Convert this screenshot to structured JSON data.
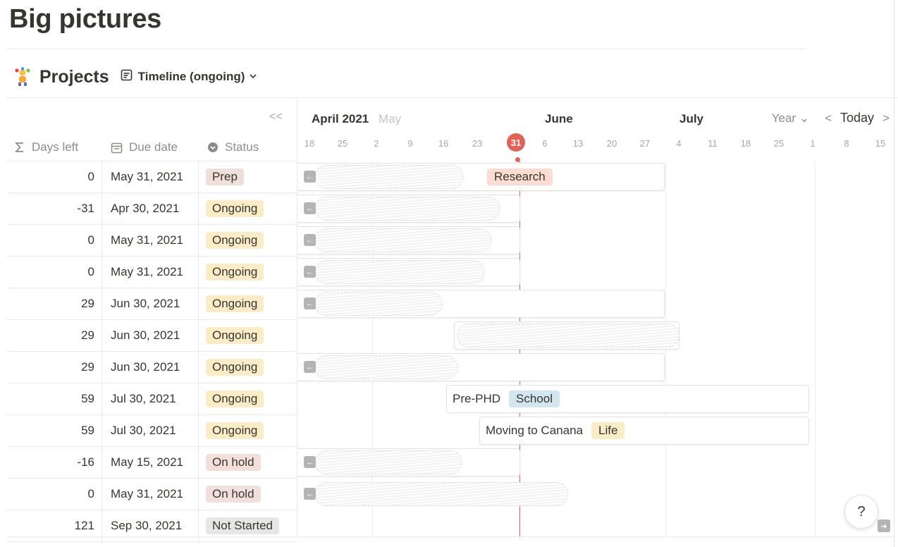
{
  "page": {
    "title": "Big pictures"
  },
  "database": {
    "name": "Projects",
    "view_label": "Timeline (ongoing)",
    "emoji": "juggler-icon"
  },
  "columns": {
    "days_left": "Days left",
    "due_date": "Due date",
    "status": "Status"
  },
  "rows": [
    {
      "days_left": "0",
      "due_date": "May 31, 2021",
      "status": "Prep",
      "status_kind": "prep"
    },
    {
      "days_left": "-31",
      "due_date": "Apr 30, 2021",
      "status": "Ongoing",
      "status_kind": "ongoing"
    },
    {
      "days_left": "0",
      "due_date": "May 31, 2021",
      "status": "Ongoing",
      "status_kind": "ongoing"
    },
    {
      "days_left": "0",
      "due_date": "May 31, 2021",
      "status": "Ongoing",
      "status_kind": "ongoing"
    },
    {
      "days_left": "29",
      "due_date": "Jun 30, 2021",
      "status": "Ongoing",
      "status_kind": "ongoing"
    },
    {
      "days_left": "29",
      "due_date": "Jun 30, 2021",
      "status": "Ongoing",
      "status_kind": "ongoing"
    },
    {
      "days_left": "29",
      "due_date": "Jun 30, 2021",
      "status": "Ongoing",
      "status_kind": "ongoing"
    },
    {
      "days_left": "59",
      "due_date": "Jul 30, 2021",
      "status": "Ongoing",
      "status_kind": "ongoing"
    },
    {
      "days_left": "59",
      "due_date": "Jul 30, 2021",
      "status": "Ongoing",
      "status_kind": "ongoing"
    },
    {
      "days_left": "-16",
      "due_date": "May 15, 2021",
      "status": "On hold",
      "status_kind": "hold"
    },
    {
      "days_left": "0",
      "due_date": "May 31, 2021",
      "status": "On hold",
      "status_kind": "hold"
    },
    {
      "days_left": "121",
      "due_date": "Sep 30, 2021",
      "status": "Not Started",
      "status_kind": "notstarted"
    }
  ],
  "timeline": {
    "months": {
      "april": "April 2021",
      "may": "May",
      "june": "June",
      "july": "July"
    },
    "days": [
      "18",
      "25",
      "2",
      "9",
      "16",
      "23",
      "31",
      "6",
      "13",
      "20",
      "27",
      "4",
      "11",
      "18",
      "25",
      "1",
      "8",
      "15"
    ],
    "today_day": "31",
    "controls": {
      "year": "Year",
      "today": "Today"
    },
    "bars": [
      {
        "row": 0,
        "label": "",
        "tag": "Research",
        "tag_kind": "research"
      },
      {
        "row": 7,
        "label": "Pre-PHD",
        "tag": "School",
        "tag_kind": "school"
      },
      {
        "row": 8,
        "label": "Moving to Canana",
        "tag": "Life",
        "tag_kind": "life"
      }
    ]
  },
  "help": {
    "label": "?"
  },
  "colors": {
    "today": "#e16259",
    "text": "#37352f",
    "muted": "#8e8c87"
  }
}
